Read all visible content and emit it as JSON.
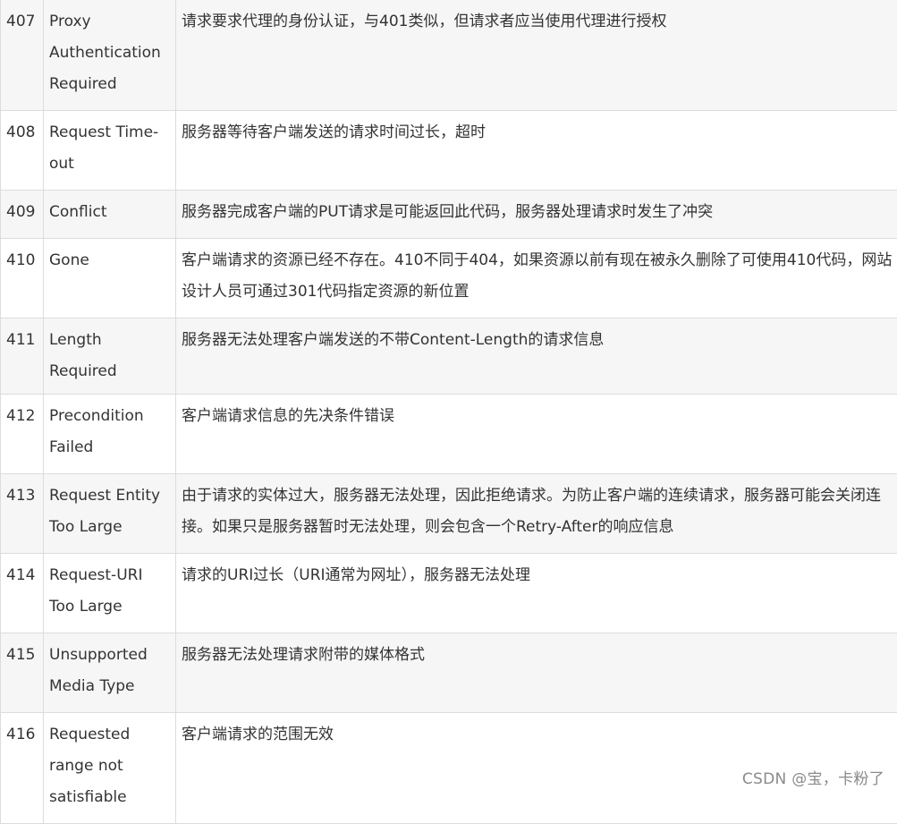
{
  "rows": [
    {
      "code": "407",
      "name": "Proxy Authentication Required",
      "desc": "请求要求代理的身份认证，与401类似，但请求者应当使用代理进行授权"
    },
    {
      "code": "408",
      "name": "Request Time-out",
      "desc": "服务器等待客户端发送的请求时间过长，超时"
    },
    {
      "code": "409",
      "name": "Conflict",
      "desc": "服务器完成客户端的PUT请求是可能返回此代码，服务器处理请求时发生了冲突"
    },
    {
      "code": "410",
      "name": "Gone",
      "desc": "客户端请求的资源已经不存在。410不同于404，如果资源以前有现在被永久删除了可使用410代码，网站设计人员可通过301代码指定资源的新位置"
    },
    {
      "code": "411",
      "name": "Length Required",
      "desc": "服务器无法处理客户端发送的不带Content-Length的请求信息"
    },
    {
      "code": "412",
      "name": "Precondition Failed",
      "desc": "客户端请求信息的先决条件错误"
    },
    {
      "code": "413",
      "name": "Request Entity Too Large",
      "desc": "由于请求的实体过大，服务器无法处理，因此拒绝请求。为防止客户端的连续请求，服务器可能会关闭连接。如果只是服务器暂时无法处理，则会包含一个Retry-After的响应信息"
    },
    {
      "code": "414",
      "name": "Request-URI Too Large",
      "desc": "请求的URI过长（URI通常为网址），服务器无法处理"
    },
    {
      "code": "415",
      "name": "Unsupported Media Type",
      "desc": "服务器无法处理请求附带的媒体格式"
    },
    {
      "code": "416",
      "name": "Requested range not satisfiable",
      "desc": "客户端请求的范围无效"
    }
  ],
  "watermark": "CSDN @宝，卡粉了"
}
